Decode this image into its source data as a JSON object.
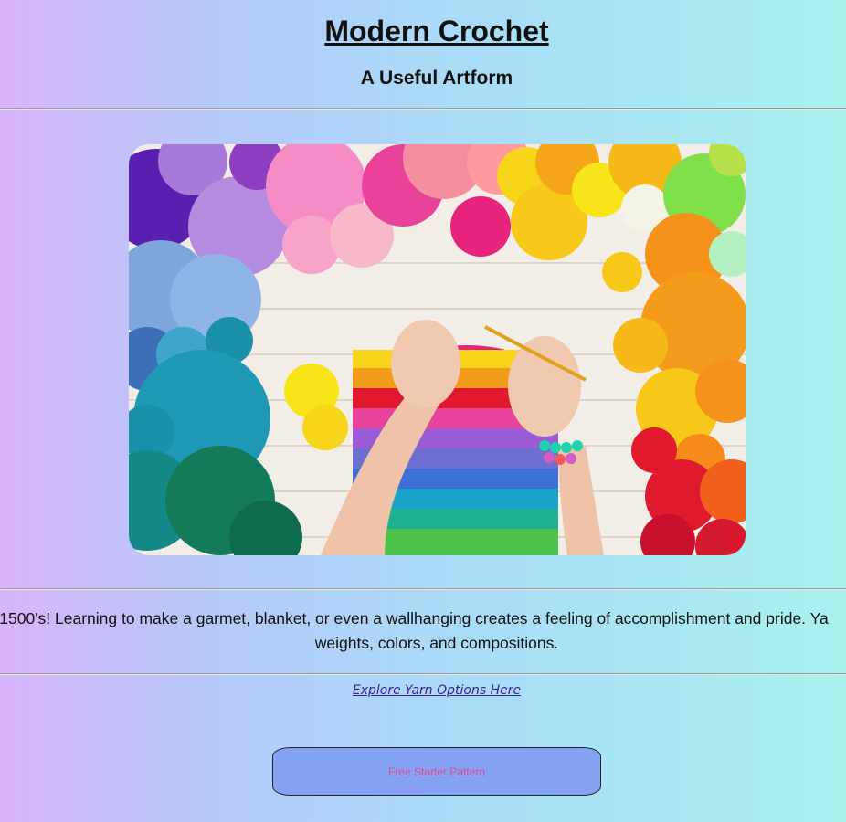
{
  "header": {
    "title": "Modern Crochet",
    "subtitle": "A Useful Artform"
  },
  "hero": {
    "alt": "Hands crocheting a rainbow-striped piece surrounded by balls of colorful yarn",
    "colors": {
      "purple": "#7b3fc9",
      "lavender": "#b98be0",
      "pink": "#f37fc0",
      "magenta": "#e8237d",
      "yellow": "#f7d51a",
      "orange": "#f59b1b",
      "red": "#e1192e",
      "teal": "#1a8fa8",
      "green": "#137a5a",
      "blue": "#7ea6dd",
      "wood": "#f3eee8"
    }
  },
  "intro": {
    "line1": "1500's! Learning to make a garmet, blanket, or even a wallhanging creates a feeling of accomplishment and pride. Ya",
    "line2": "weights, colors, and compositions."
  },
  "links": {
    "explore": "Explore Yarn Options Here"
  },
  "cta": {
    "label": "Free Starter Pattern"
  },
  "theme": {
    "gradient_start": "#d7b4fa",
    "gradient_end": "#a9f2ee",
    "button_bg": "#83a2f3",
    "button_text": "#e2458f",
    "link_color": "#3c1f8c"
  }
}
